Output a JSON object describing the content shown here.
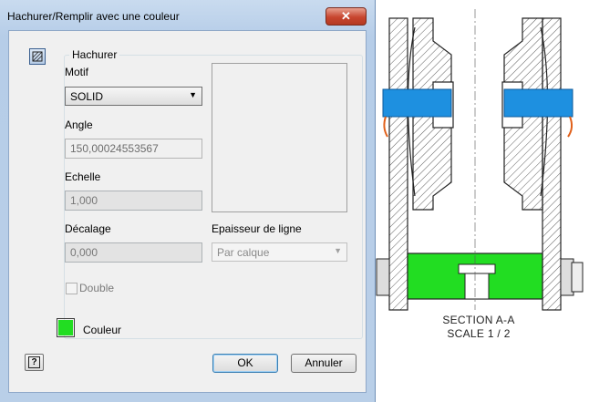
{
  "window": {
    "title": "Hachurer/Remplir avec une couleur",
    "close_glyph": "✕"
  },
  "hatch_group": {
    "title": "Hachurer",
    "pattern_label": "Motif",
    "pattern_value": "SOLID",
    "angle_label": "Angle",
    "angle_value": "150,00024553567",
    "scale_label": "Echelle",
    "scale_value": "1,000",
    "offset_label": "Décalage",
    "offset_value": "0,000",
    "line_weight_label": "Epaisseur de ligne",
    "line_weight_value": "Par calque",
    "double_label": "Double",
    "double_checked": false
  },
  "color": {
    "label": "Couleur",
    "swatch": "#22dd22"
  },
  "buttons": {
    "help": "?",
    "ok": "OK",
    "cancel": "Annuler"
  },
  "drawing": {
    "section_label": "SECTION A-A",
    "scale_label": "SCALE 1 / 2",
    "accent_blue": "#1e90e0",
    "accent_green": "#22dd22",
    "accent_orange": "#e0601a"
  }
}
